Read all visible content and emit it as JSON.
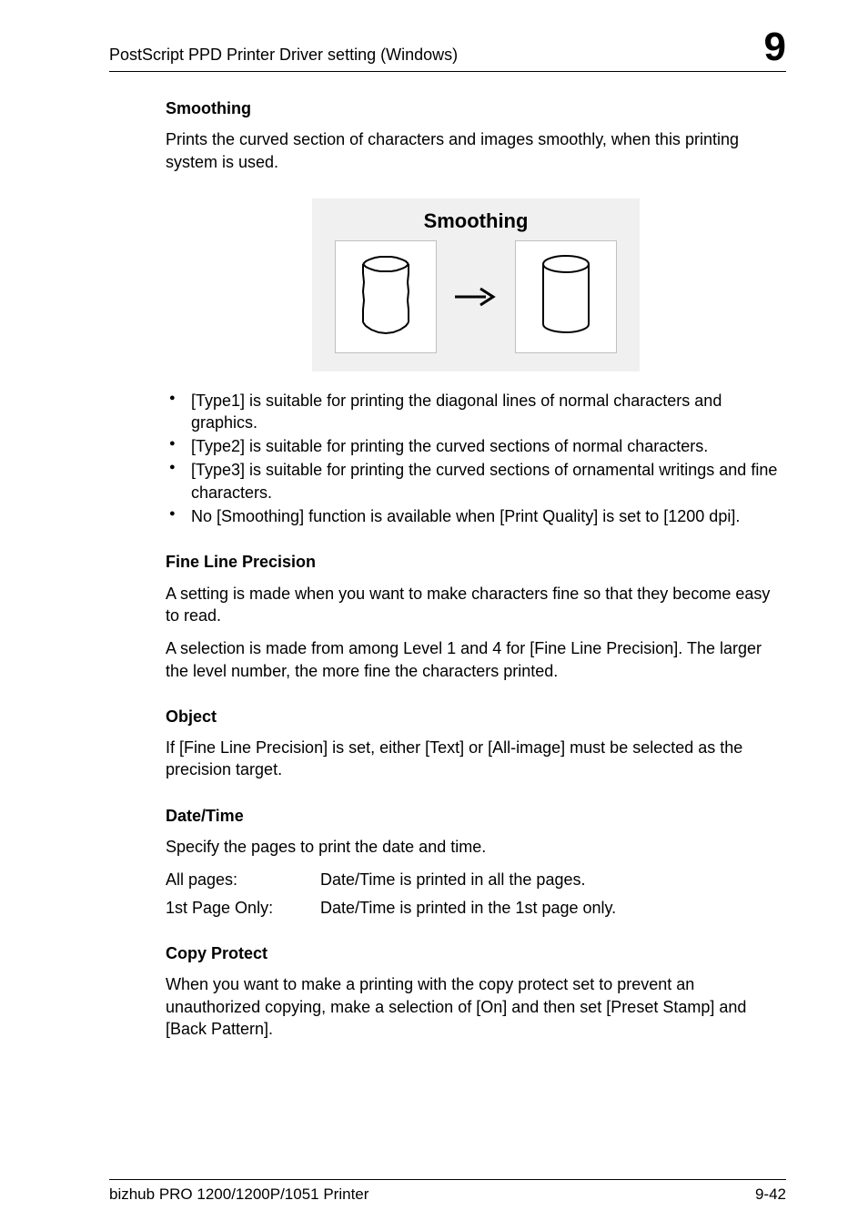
{
  "header": {
    "left": "PostScript PPD Printer Driver setting (Windows)",
    "right": "9"
  },
  "sections": {
    "smoothing": {
      "title": "Smoothing",
      "intro": "Prints the curved section of characters and images smoothly, when this printing system is used.",
      "figure_title": "Smoothing",
      "bullets": [
        "[Type1] is suitable for printing the diagonal lines of normal characters and graphics.",
        "[Type2] is suitable for printing the curved sections of normal characters.",
        "[Type3] is suitable for printing the curved sections of ornamental writings and fine characters.",
        "No [Smoothing] function is available when [Print Quality] is set to [1200 dpi]."
      ]
    },
    "fine_line": {
      "title": "Fine Line Precision",
      "p1": "A setting is made when you want to make characters fine so that they become easy to read.",
      "p2": "A selection is made from among Level 1 and 4 for [Fine Line Precision]. The larger the level number, the more fine the characters printed."
    },
    "object": {
      "title": "Object",
      "p": "If [Fine Line Precision] is set, either [Text] or [All-image] must be selected as the precision target."
    },
    "datetime": {
      "title": "Date/Time",
      "intro": "Specify the pages to print the date and time.",
      "rows": [
        {
          "label": "All pages:",
          "value": "Date/Time is printed in all the pages."
        },
        {
          "label": "1st Page Only:",
          "value": "Date/Time is printed in the 1st page only."
        }
      ]
    },
    "copy_protect": {
      "title": "Copy Protect",
      "p": "When you want to make a printing with the copy protect set to prevent an unauthorized copying, make a selection of [On] and then set [Preset Stamp] and [Back Pattern]."
    }
  },
  "footer": {
    "left": "bizhub PRO 1200/1200P/1051 Printer",
    "right": "9-42"
  }
}
